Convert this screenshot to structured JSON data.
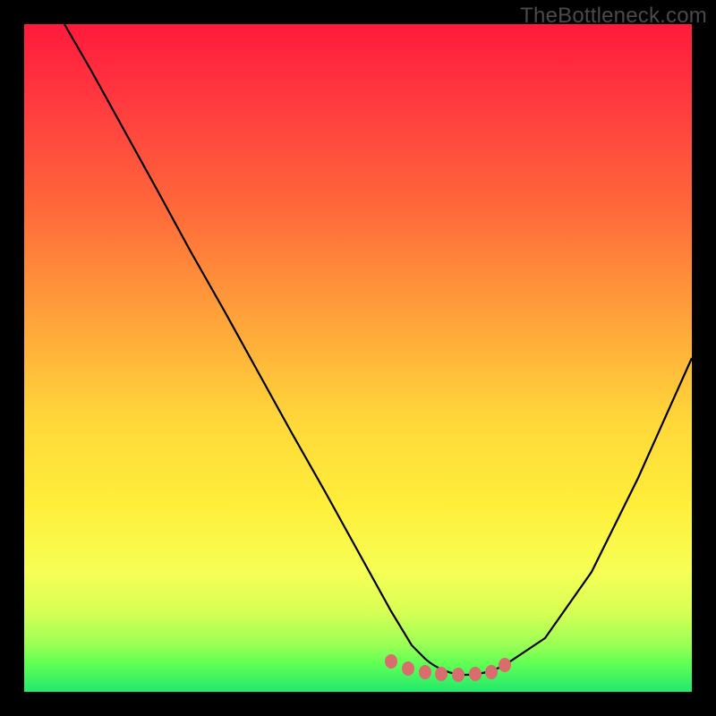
{
  "watermark": {
    "text": "TheBottleneck.com"
  },
  "colors": {
    "page_bg": "#000000",
    "gradient_stops": [
      {
        "pos": 0.0,
        "hex": "#ff1a3c"
      },
      {
        "pos": 0.12,
        "hex": "#ff3b3f"
      },
      {
        "pos": 0.28,
        "hex": "#ff6a3a"
      },
      {
        "pos": 0.45,
        "hex": "#ffa63a"
      },
      {
        "pos": 0.6,
        "hex": "#ffd93a"
      },
      {
        "pos": 0.72,
        "hex": "#ffee3a"
      },
      {
        "pos": 0.82,
        "hex": "#f6ff55"
      },
      {
        "pos": 0.88,
        "hex": "#d8ff55"
      },
      {
        "pos": 0.93,
        "hex": "#9aff55"
      },
      {
        "pos": 0.96,
        "hex": "#5cff55"
      },
      {
        "pos": 1.0,
        "hex": "#22e86e"
      }
    ],
    "curve_stroke": "#000000",
    "marker_fill": "#d96c6c"
  },
  "chart_data": {
    "type": "line",
    "title": "",
    "xlabel": "",
    "ylabel": "",
    "xlim": [
      0,
      100
    ],
    "ylim": [
      0,
      100
    ],
    "grid": false,
    "legend": null,
    "series": [
      {
        "name": "bottleneck-curve",
        "x": [
          6,
          10,
          15,
          20,
          25,
          30,
          35,
          40,
          45,
          50,
          55,
          58,
          60,
          63,
          66,
          70,
          72,
          78,
          85,
          92,
          100
        ],
        "y": [
          100,
          93,
          84,
          75,
          66,
          57,
          48,
          39,
          30,
          21,
          12,
          7,
          5,
          3,
          2.5,
          2.5,
          3,
          8,
          18,
          32,
          50
        ]
      }
    ],
    "markers": {
      "name": "flat-bottom-dots",
      "x": [
        55,
        57.5,
        60,
        62.5,
        65,
        67.5,
        70,
        72
      ],
      "y": [
        4.5,
        3.5,
        3,
        2.7,
        2.6,
        2.7,
        3,
        4
      ]
    },
    "notes": "Axes unlabeled; values estimated from pixel positions on a 0–100 normalized scale. Curve descends steeply from top-left, flattens near x≈55–72 at y≈2.5–4, then rises to the right edge around y≈50."
  }
}
